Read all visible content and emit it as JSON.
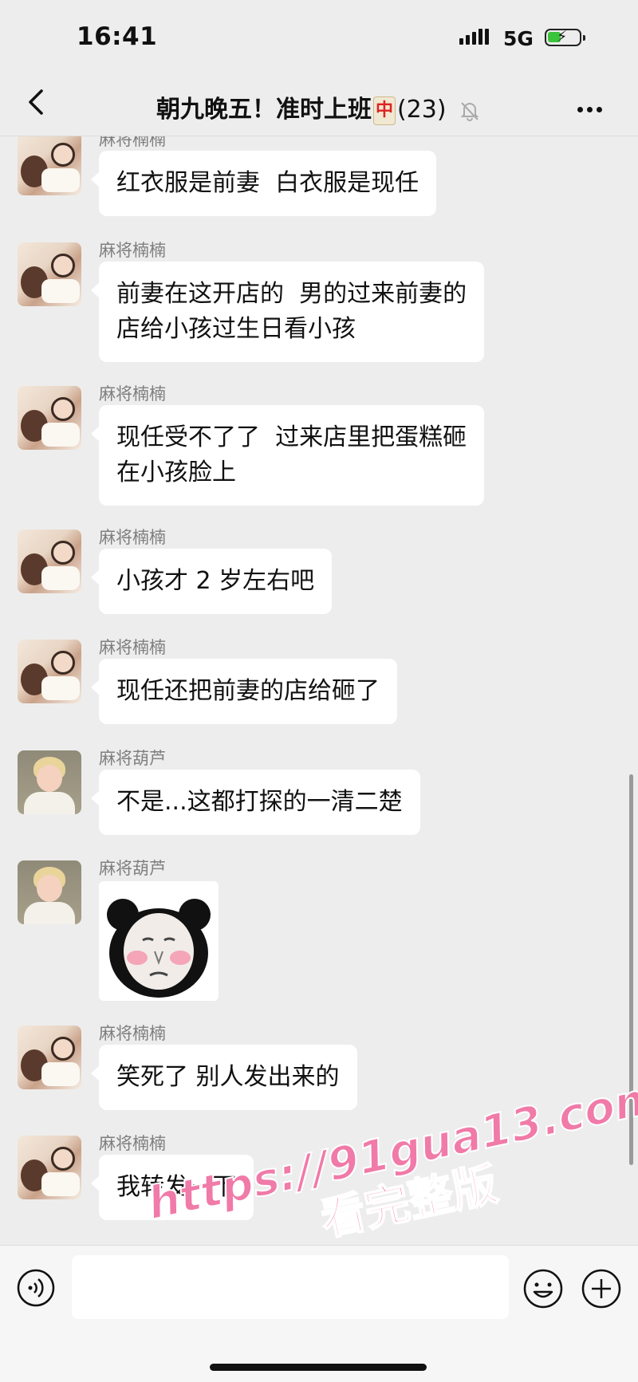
{
  "status": {
    "time": "16:41",
    "network": "5G"
  },
  "nav": {
    "title": "朝九晚五！准时上班",
    "tile": "中",
    "count": "(23)"
  },
  "messages": [
    {
      "sender": "麻将楠楠",
      "text": "红衣服是前妻  白衣服是现任"
    },
    {
      "sender": "麻将楠楠",
      "text": "前妻在这开店的  男的过来前妻的\n店给小孩过生日看小孩"
    },
    {
      "sender": "麻将楠楠",
      "text": "现任受不了了  过来店里把蛋糕砸\n在小孩脸上"
    },
    {
      "sender": "麻将楠楠",
      "text": "小孩才 2 岁左右吧"
    },
    {
      "sender": "麻将楠楠",
      "text": "现任还把前妻的店给砸了"
    },
    {
      "sender": "麻将葫芦",
      "text": "不是...这都打探的一清二楚"
    },
    {
      "sender": "麻将葫芦",
      "sticker": "panda-face-sticker"
    },
    {
      "sender": "麻将楠楠",
      "text": "笑死了 别人发出来的"
    },
    {
      "sender": "麻将楠楠",
      "text": "我转发一下"
    }
  ],
  "watermark": {
    "line1": "https://91gua13.com",
    "line2": "看完整版"
  },
  "colors": {
    "background": "#ededed",
    "bubble": "#ffffff",
    "watermark": "#f07aa8",
    "battery": "#3cc33c"
  },
  "icons": [
    "back-icon",
    "mute-bell-icon",
    "more-icon",
    "voice-icon",
    "emoji-icon",
    "plus-icon"
  ]
}
